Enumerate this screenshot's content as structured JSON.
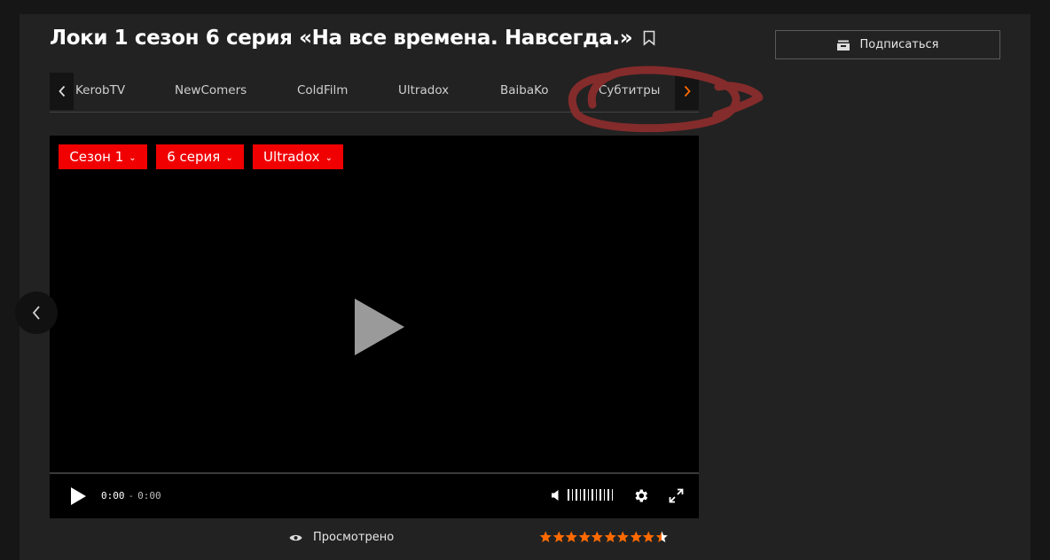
{
  "page": {
    "title": "Локи 1 сезон 6 серия «На все времена. Навсегда.»"
  },
  "subscribe": {
    "label": "Подписаться"
  },
  "tabs": {
    "items": [
      "KerobTV",
      "NewComers",
      "ColdFilm",
      "Ultradox",
      "BaibaKo",
      "Субтитры"
    ],
    "prev_icon": "chevron-left-icon",
    "next_icon": "chevron-right-icon"
  },
  "player": {
    "season_label": "Сезон 1",
    "episode_label": "6 серия",
    "voice_label": "Ultradox",
    "time_current": "0:00",
    "time_separator": "-",
    "time_duration": "0:00",
    "progress": 0,
    "volume_level": 1
  },
  "footer": {
    "watched_label": "Просмотрено",
    "rating": 9.5,
    "rating_max": 10
  },
  "colors": {
    "accent": "#f00000",
    "orange": "#ff6a00",
    "background": "#222222",
    "scribble": "#8a2c2c"
  }
}
